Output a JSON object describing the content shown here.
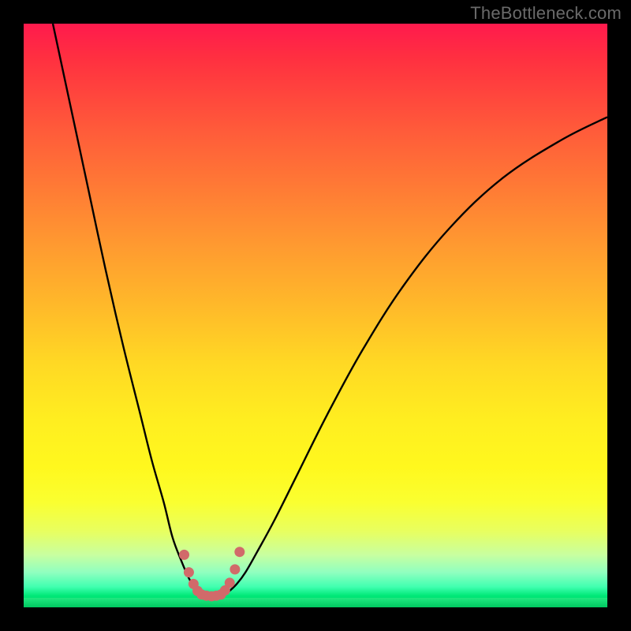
{
  "watermark": {
    "text": "TheBottleneck.com"
  },
  "colors": {
    "background": "#000000",
    "curve": "#000000",
    "marker": "#d16a6a",
    "gradient_top": "#ff1a4d",
    "gradient_bottom": "#00d068"
  },
  "chart_data": {
    "type": "line",
    "title": "",
    "xlabel": "",
    "ylabel": "",
    "xlim": [
      0,
      100
    ],
    "ylim": [
      0,
      100
    ],
    "grid": false,
    "legend": false,
    "series": [
      {
        "name": "left-branch",
        "x": [
          5,
          8,
          11,
          14,
          17,
          20,
          22,
          24,
          25.5,
          27,
          28.3,
          29.2,
          30,
          30.8
        ],
        "y": [
          100,
          86,
          72,
          58,
          45,
          33,
          25,
          18,
          12,
          8,
          5,
          3.5,
          2.5,
          2.0
        ]
      },
      {
        "name": "right-branch",
        "x": [
          34,
          35,
          36.5,
          38,
          40,
          43,
          47,
          52,
          58,
          65,
          73,
          82,
          92,
          100
        ],
        "y": [
          2.0,
          2.6,
          4.0,
          6.0,
          9.5,
          15,
          23,
          33,
          44,
          55,
          65,
          73.5,
          80,
          84
        ]
      },
      {
        "name": "valley-floor",
        "x": [
          30.8,
          32.4,
          34
        ],
        "y": [
          2.0,
          1.9,
          2.0
        ]
      }
    ],
    "marker_region": {
      "name": "optimal-zone",
      "x": [
        27.5,
        28.3,
        29.1,
        29.8,
        30.5,
        31.3,
        32.2,
        33.0,
        33.8,
        34.5,
        35.3,
        36.2,
        37.0
      ],
      "y": [
        9.0,
        6.0,
        4.0,
        2.8,
        2.2,
        2.0,
        1.9,
        2.0,
        2.2,
        2.9,
        4.2,
        6.5,
        9.5
      ]
    }
  }
}
